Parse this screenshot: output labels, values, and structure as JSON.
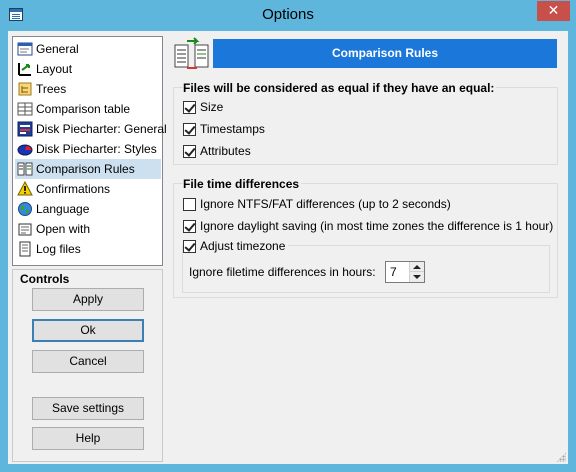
{
  "window": {
    "title": "Options",
    "close_label": "✕"
  },
  "tree": {
    "items": [
      {
        "label": "General",
        "icon": "general-icon",
        "selected": false
      },
      {
        "label": "Layout",
        "icon": "layout-icon",
        "selected": false
      },
      {
        "label": "Trees",
        "icon": "trees-icon",
        "selected": false
      },
      {
        "label": "Comparison table",
        "icon": "comparison-table-icon",
        "selected": false
      },
      {
        "label": "Disk Piecharter: General",
        "icon": "disk-piecharter-icon",
        "selected": false
      },
      {
        "label": "Disk Piecharter: Styles",
        "icon": "disk-styles-icon",
        "selected": false
      },
      {
        "label": "Comparison Rules",
        "icon": "comparison-rules-icon",
        "selected": true
      },
      {
        "label": "Confirmations",
        "icon": "warning-icon",
        "selected": false
      },
      {
        "label": "Language",
        "icon": "globe-icon",
        "selected": false
      },
      {
        "label": "Open with",
        "icon": "open-with-icon",
        "selected": false
      },
      {
        "label": "Log files",
        "icon": "log-files-icon",
        "selected": false
      }
    ]
  },
  "controls": {
    "title": "Controls",
    "apply": "Apply",
    "ok": "Ok",
    "cancel": "Cancel",
    "save_settings": "Save settings",
    "help": "Help"
  },
  "panel": {
    "header": "Comparison Rules",
    "equal_group": {
      "title": "Files will be considered as equal if they have an equal:",
      "size": {
        "label": "Size",
        "checked": true
      },
      "timestamps": {
        "label": "Timestamps",
        "checked": true
      },
      "attributes": {
        "label": "Attributes",
        "checked": true
      }
    },
    "time_group": {
      "title": "File time differences",
      "ignore_ntfs": {
        "label": "Ignore NTFS/FAT differences (up to 2 seconds)",
        "checked": false
      },
      "ignore_dst": {
        "label": "Ignore daylight saving (in most time zones the difference is 1 hour)",
        "checked": true
      },
      "adjust_timezone": {
        "label": "Adjust timezone",
        "checked": true
      },
      "ignore_hours": {
        "label": "Ignore filetime differences in hours:",
        "value": "7"
      }
    }
  },
  "colors": {
    "window_frame": "#5fb6dd",
    "header_bar": "#1b78da",
    "selection": "#cde0ef",
    "close_button": "#c7504b"
  }
}
